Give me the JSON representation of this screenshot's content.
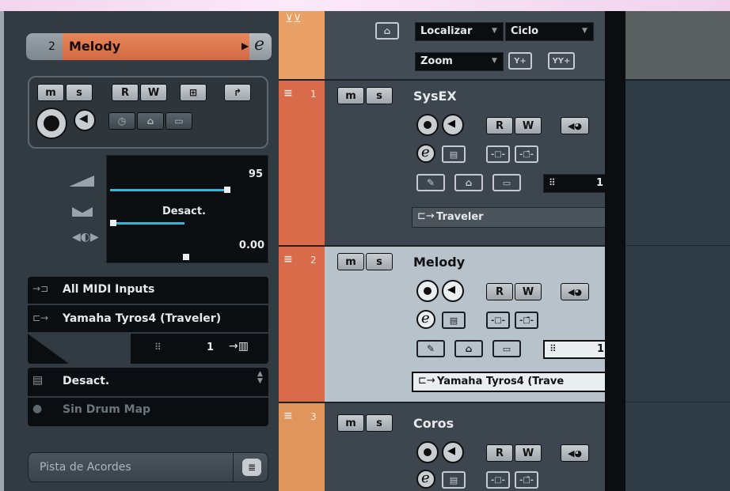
{
  "inspector": {
    "track_number": "2",
    "track_name": "Melody",
    "edit_symbol": "e",
    "buttons": {
      "mute": "m",
      "solo": "s",
      "read": "R",
      "write": "W"
    },
    "volume_value": "95",
    "pan_value": "Desact.",
    "delay_value": "0.00",
    "input": "All MIDI Inputs",
    "output": "Yamaha Tyros4 (Traveler)",
    "channel": "1",
    "program": "Desact.",
    "drum_map": "Sin Drum Map",
    "chord_track": "Pista de Acordes"
  },
  "toolbar": {
    "locate_label": "Localizar",
    "cycle_label": "Ciclo",
    "zoom_label": "Zoom"
  },
  "tracks": [
    {
      "number": "1",
      "name": "SysEX",
      "channel": "1",
      "output": "Traveler",
      "color": "#d96a4a"
    },
    {
      "number": "2",
      "name": "Melody",
      "channel": "1",
      "output": "Yamaha Tyros4 (Trave",
      "color": "#d96a4a"
    },
    {
      "number": "3",
      "name": "Coros",
      "channel": "",
      "output": "",
      "color": "#e0955c"
    }
  ],
  "track_buttons": {
    "mute": "m",
    "solo": "s",
    "read": "R",
    "write": "W",
    "edit": "e"
  },
  "colors": {
    "accent_orange": "#e0804f",
    "selected_track_bg": "#b8c2cb",
    "track_bg": "#3d464e",
    "header_orange": "#e8a066"
  }
}
